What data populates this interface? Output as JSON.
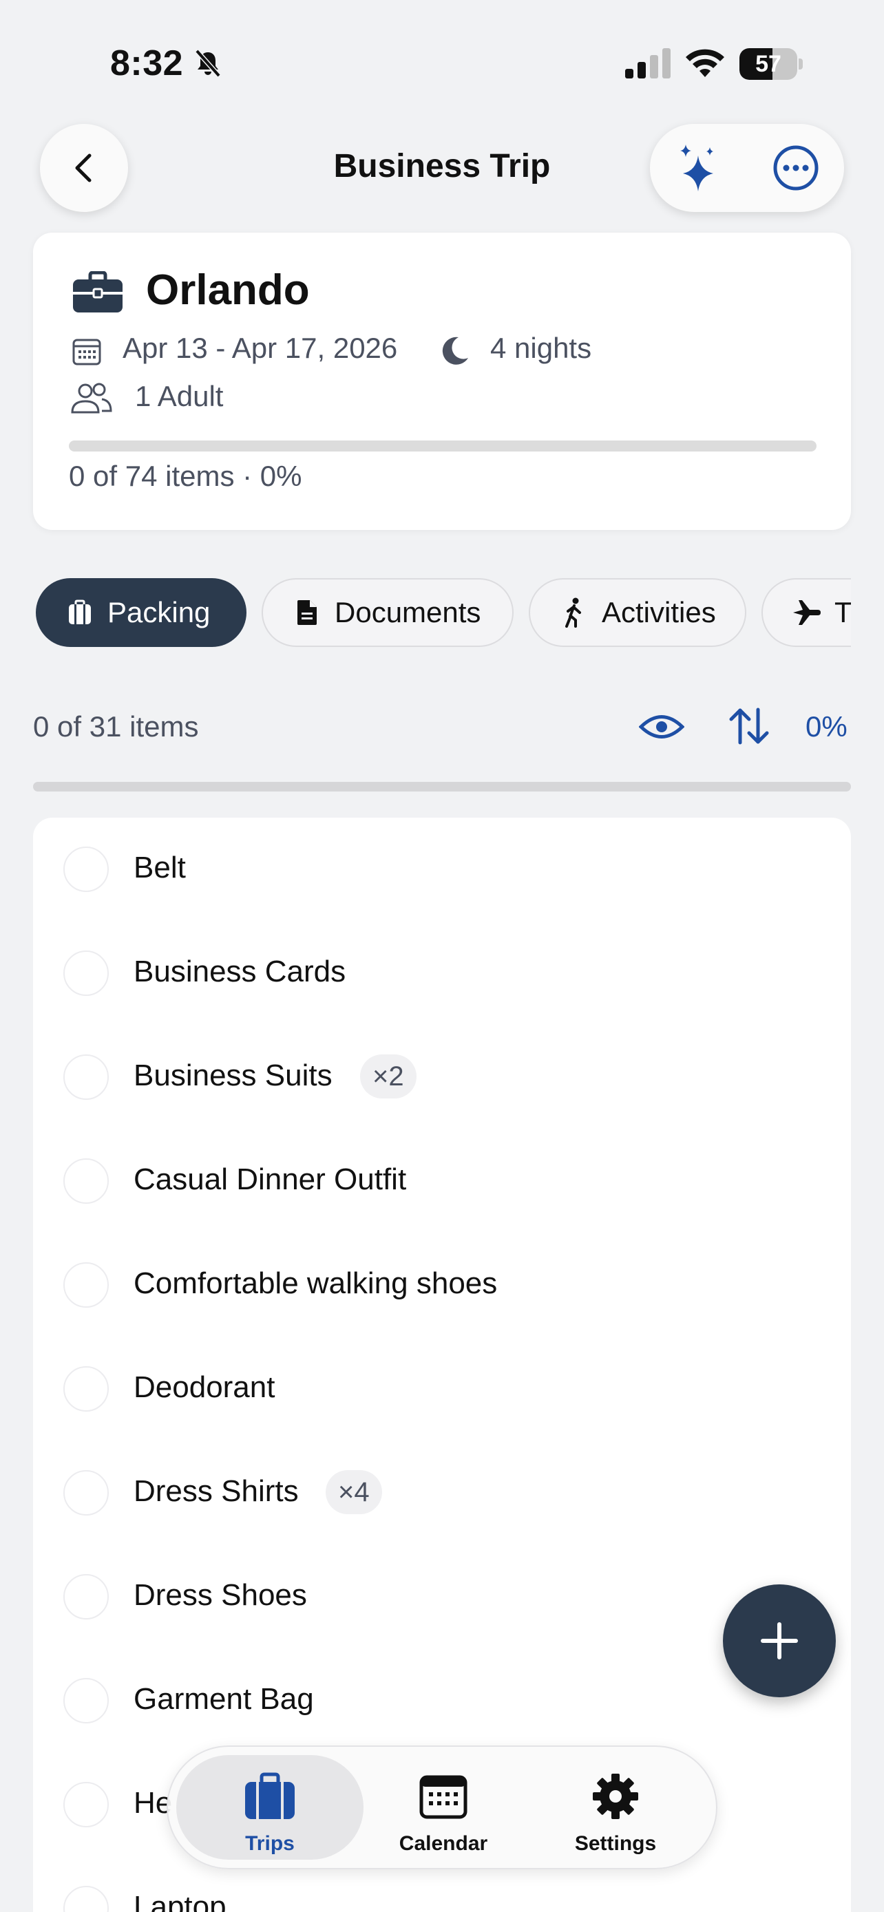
{
  "status_bar": {
    "time": "8:32",
    "battery": "57",
    "battery_level": 0.57
  },
  "header": {
    "title": "Business Trip"
  },
  "trip": {
    "city": "Orlando",
    "dates": "Apr 13 - Apr 17, 2026",
    "nights": "4 nights",
    "travelers": "1 Adult",
    "progress_text": "0 of 74 items · 0%",
    "progress_fraction": 0
  },
  "tabs": [
    {
      "label": "Packing",
      "icon": "suitcase-icon",
      "active": true
    },
    {
      "label": "Documents",
      "icon": "document-icon",
      "active": false
    },
    {
      "label": "Activities",
      "icon": "walking-icon",
      "active": false
    },
    {
      "label": "Tr",
      "icon": "airplane-icon",
      "active": false
    }
  ],
  "list_header": {
    "count": "0 of 31 items",
    "percent": "0%",
    "progress_fraction": 0
  },
  "items": [
    {
      "label": "Belt"
    },
    {
      "label": "Business Cards"
    },
    {
      "label": "Business Suits",
      "qty": "×2"
    },
    {
      "label": "Casual Dinner Outfit"
    },
    {
      "label": "Comfortable walking shoes"
    },
    {
      "label": "Deodorant"
    },
    {
      "label": "Dress Shirts",
      "qty": "×4"
    },
    {
      "label": "Dress Shoes"
    },
    {
      "label": "Garment Bag"
    },
    {
      "label": "He"
    },
    {
      "label": "Laptop"
    }
  ],
  "tab_bar": [
    {
      "label": "Trips",
      "icon": "suitcase-icon",
      "selected": true
    },
    {
      "label": "Calendar",
      "icon": "calendar-icon",
      "selected": false
    },
    {
      "label": "Settings",
      "icon": "gear-icon",
      "selected": false
    }
  ],
  "colors": {
    "accent": "#1e4fa5",
    "dark": "#2b3a4d",
    "background": "#f1f2f4"
  }
}
